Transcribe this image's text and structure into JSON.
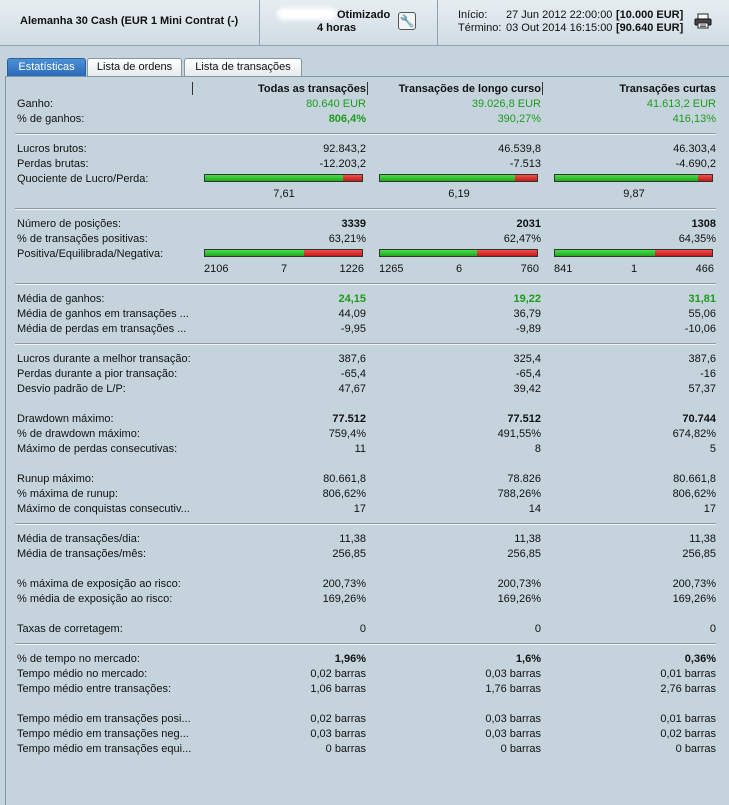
{
  "header": {
    "instrument": "Alemanha 30 Cash (EUR 1 Mini Contrat (-)",
    "opt_line1": "Otimizado",
    "opt_line2": "4 horas",
    "start_label": "Início:",
    "start_value": "27 Jun 2012 22:00:00",
    "start_capital": "[10.000 EUR]",
    "end_label": "Término:",
    "end_value": "03 Out 2014 16:15:00",
    "end_capital": "[90.640 EUR]",
    "icons": [
      "wrench-icon",
      "printer-icon"
    ]
  },
  "tabs": [
    "Estatísticas",
    "Lista de ordens",
    "Lista de transações"
  ],
  "active_tab": 0,
  "columns": [
    "Todas as transações",
    "Transações de longo curso",
    "Transações curtas"
  ],
  "colors": {
    "green": "#1e9a1e",
    "bar_green": "#2ec22e",
    "bar_red": "#d52222",
    "tab_active": "#3a7ccb"
  },
  "rows": {
    "ganho": {
      "label": "Ganho:",
      "v": [
        "80.640 EUR",
        "39.026,8 EUR",
        "41.613,2 EUR"
      ]
    },
    "pct_ganhos": {
      "label": "% de ganhos:",
      "v": [
        "806,4%",
        "390,27%",
        "416,13%"
      ]
    },
    "lucros_brutos": {
      "label": "Lucros brutos:",
      "v": [
        "92.843,2",
        "46.539,8",
        "46.303,4"
      ]
    },
    "perdas_brutas": {
      "label": "Perdas brutas:",
      "v": [
        "-12.203,2",
        "-7.513",
        "-4.690,2"
      ]
    },
    "quociente": {
      "label": "Quociente de Lucro/Perda:",
      "v": [
        "7,61",
        "6,19",
        "9,87"
      ]
    },
    "num_posicoes": {
      "label": "Número de posições:",
      "v": [
        "3339",
        "2031",
        "1308"
      ]
    },
    "pct_positivas": {
      "label": "% de transações positivas:",
      "v": [
        "63,21%",
        "62,47%",
        "64,35%"
      ]
    },
    "pos_eq_neg": {
      "label": "Positiva/Equilibrada/Negativa:",
      "pos": [
        "2106",
        "1265",
        "841"
      ],
      "eq": [
        "7",
        "6",
        "1"
      ],
      "neg": [
        "1226",
        "760",
        "466"
      ]
    },
    "media_ganhos": {
      "label": "Média de ganhos:",
      "v": [
        "24,15",
        "19,22",
        "31,81"
      ]
    },
    "media_ganhos_trans": {
      "label": "Média de ganhos em transações ...",
      "v": [
        "44,09",
        "36,79",
        "55,06"
      ]
    },
    "media_perdas_trans": {
      "label": "Média de perdas em transações ...",
      "v": [
        "-9,95",
        "-9,89",
        "-10,06"
      ]
    },
    "lucros_melhor": {
      "label": "Lucros durante a melhor transação:",
      "v": [
        "387,6",
        "325,4",
        "387,6"
      ]
    },
    "perdas_pior": {
      "label": "Perdas durante a pior transação:",
      "v": [
        "-65,4",
        "-65,4",
        "-16"
      ]
    },
    "desvio": {
      "label": "Desvio padrão de L/P:",
      "v": [
        "47,67",
        "39,42",
        "57,37"
      ]
    },
    "drawdown": {
      "label": "Drawdown máximo:",
      "v": [
        "77.512",
        "77.512",
        "70.744"
      ]
    },
    "pct_drawdown": {
      "label": "% de drawdown máximo:",
      "v": [
        "759,4%",
        "491,55%",
        "674,82%"
      ]
    },
    "max_perdas_consec": {
      "label": "Máximo de perdas consecutivas:",
      "v": [
        "11",
        "8",
        "5"
      ]
    },
    "runup": {
      "label": "Runup máximo:",
      "v": [
        "80.661,8",
        "78.826",
        "80.661,8"
      ]
    },
    "pct_runup": {
      "label": "% máxima de runup:",
      "v": [
        "806,62%",
        "788,26%",
        "806,62%"
      ]
    },
    "max_conquistas": {
      "label": "Máximo de conquistas consecutiv...",
      "v": [
        "17",
        "14",
        "17"
      ]
    },
    "media_dia": {
      "label": "Média de transações/dia:",
      "v": [
        "11,38",
        "11,38",
        "11,38"
      ]
    },
    "media_mes": {
      "label": "Média de transações/mês:",
      "v": [
        "256,85",
        "256,85",
        "256,85"
      ]
    },
    "max_exposicao": {
      "label": "% máxima de exposição ao risco:",
      "v": [
        "200,73%",
        "200,73%",
        "200,73%"
      ]
    },
    "media_exposicao": {
      "label": "% média de exposição ao risco:",
      "v": [
        "169,26%",
        "169,26%",
        "169,26%"
      ]
    },
    "taxas": {
      "label": "Taxas de corretagem:",
      "v": [
        "0",
        "0",
        "0"
      ]
    },
    "pct_tempo": {
      "label": "% de tempo no mercado:",
      "v": [
        "1,96%",
        "1,6%",
        "0,36%"
      ]
    },
    "tempo_medio": {
      "label": "Tempo médio no mercado:",
      "v": [
        "0,02 barras",
        "0,03 barras",
        "0,01 barras"
      ]
    },
    "tempo_entre": {
      "label": "Tempo médio entre transações:",
      "v": [
        "1,06 barras",
        "1,76 barras",
        "2,76 barras"
      ]
    },
    "tempo_pos": {
      "label": "Tempo médio em transações posi...",
      "v": [
        "0,02 barras",
        "0,03 barras",
        "0,01 barras"
      ]
    },
    "tempo_neg": {
      "label": "Tempo médio em transações neg...",
      "v": [
        "0,03 barras",
        "0,03 barras",
        "0,02 barras"
      ]
    },
    "tempo_equi": {
      "label": "Tempo médio em transações equi...",
      "v": [
        "0 barras",
        "0 barras",
        "0 barras"
      ]
    }
  },
  "profit_loss_bar": {
    "profit_share": [
      0.88,
      0.86,
      0.91
    ]
  },
  "pos_neg_bar": {
    "positive_share": [
      0.63,
      0.62,
      0.64
    ]
  }
}
